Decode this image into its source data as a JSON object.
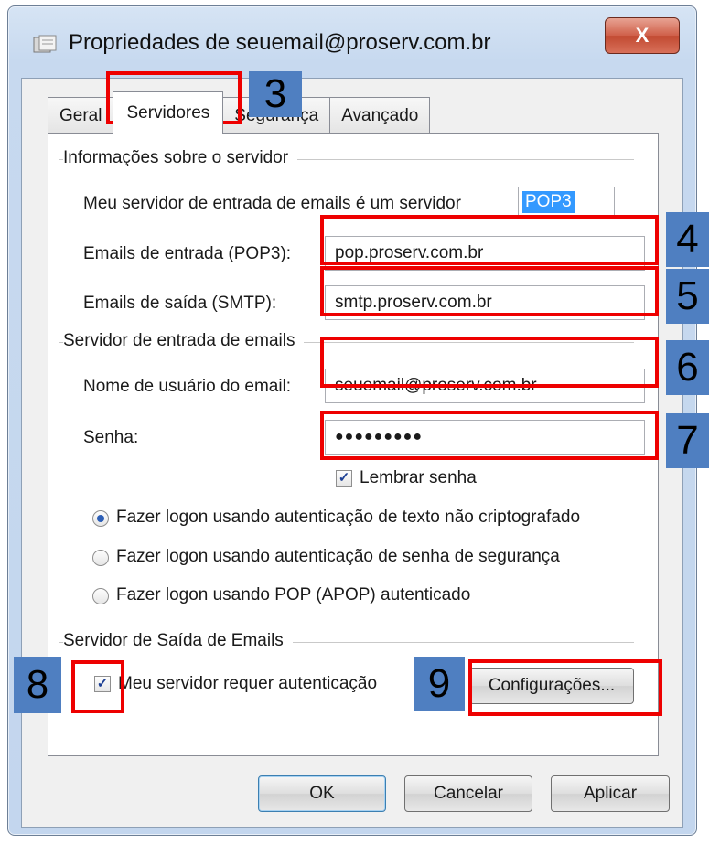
{
  "window": {
    "title": "Propriedades de seuemail@proserv.com.br",
    "close_label": "X"
  },
  "tabs": [
    {
      "label": "Geral"
    },
    {
      "label": "Servidores"
    },
    {
      "label": "Segurança"
    },
    {
      "label": "Avançado"
    }
  ],
  "server_info": {
    "group_label": "Informações sobre o servidor",
    "incoming_type_label": "Meu servidor de entrada de emails é um servidor",
    "incoming_type_value": "POP3",
    "incoming_label": "Emails de entrada (POP3):",
    "incoming_value": "pop.proserv.com.br",
    "outgoing_label": "Emails de saída (SMTP):",
    "outgoing_value": "smtp.proserv.com.br"
  },
  "incoming_server": {
    "group_label": "Servidor de entrada de emails",
    "username_label": "Nome de usuário do email:",
    "username_value": "seuemail@proserv.com.br",
    "password_label": "Senha:",
    "password_value": "●●●●●●●●●",
    "remember_label": "Lembrar senha",
    "remember_checked": true,
    "auth_options": [
      {
        "label": "Fazer logon usando autenticação de texto não criptografado",
        "selected": true
      },
      {
        "label": "Fazer logon usando autenticação de senha de segurança",
        "selected": false
      },
      {
        "label": "Fazer logon usando POP (APOP) autenticado",
        "selected": false
      }
    ]
  },
  "outgoing_server": {
    "group_label": "Servidor de Saída de Emails",
    "requires_auth_label": "Meu servidor requer autenticação",
    "requires_auth_checked": true,
    "settings_button": "Configurações..."
  },
  "footer": {
    "ok": "OK",
    "cancel": "Cancelar",
    "apply": "Aplicar"
  },
  "annotations": {
    "badge_3": "3",
    "badge_4": "4",
    "badge_5": "5",
    "badge_6": "6",
    "badge_7": "7",
    "badge_8": "8",
    "badge_9": "9",
    "highlight_color": "#ee0000",
    "badge_color": "#4f7fc1"
  },
  "icons": {
    "title_icon": "mail-account-icon",
    "check_glyph": "✓"
  }
}
